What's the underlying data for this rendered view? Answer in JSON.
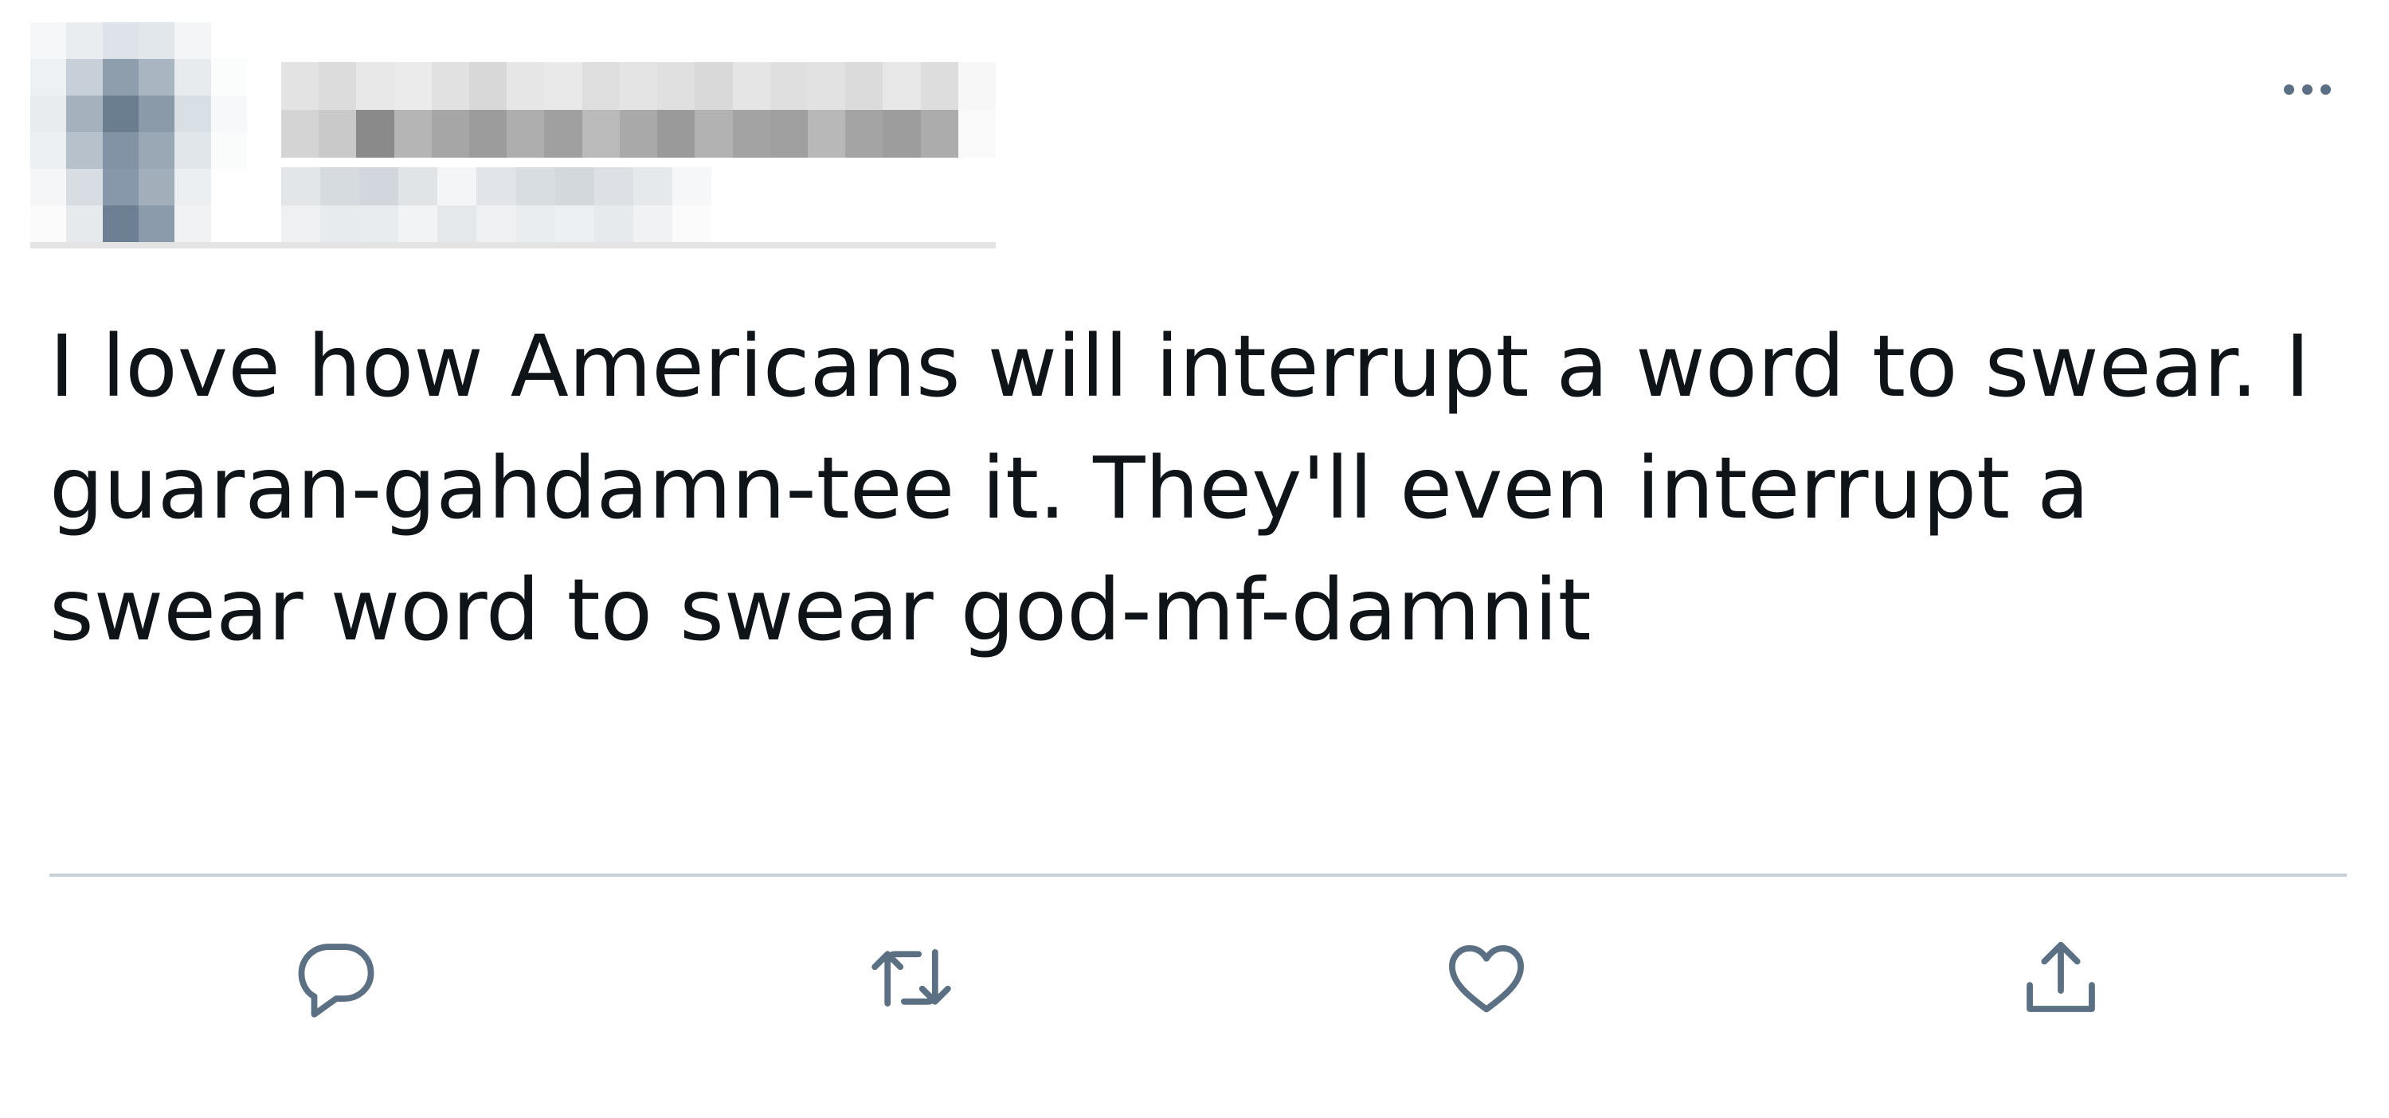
{
  "tweet": {
    "text": "I love how Americans will interrupt a word to swear. I guaran-gahdamn-tee it. They'll even interrupt a swear word to swear god-mf-damnit"
  },
  "author": {
    "redacted": true
  },
  "actions": {
    "reply_icon": "reply-icon",
    "retweet_icon": "retweet-icon",
    "like_icon": "heart-icon",
    "share_icon": "share-icon",
    "more_icon": "more-options-icon"
  },
  "colors": {
    "text": "#0f1419",
    "icon": "#5b7083",
    "divider": "#c6d1da",
    "background": "#ffffff"
  }
}
